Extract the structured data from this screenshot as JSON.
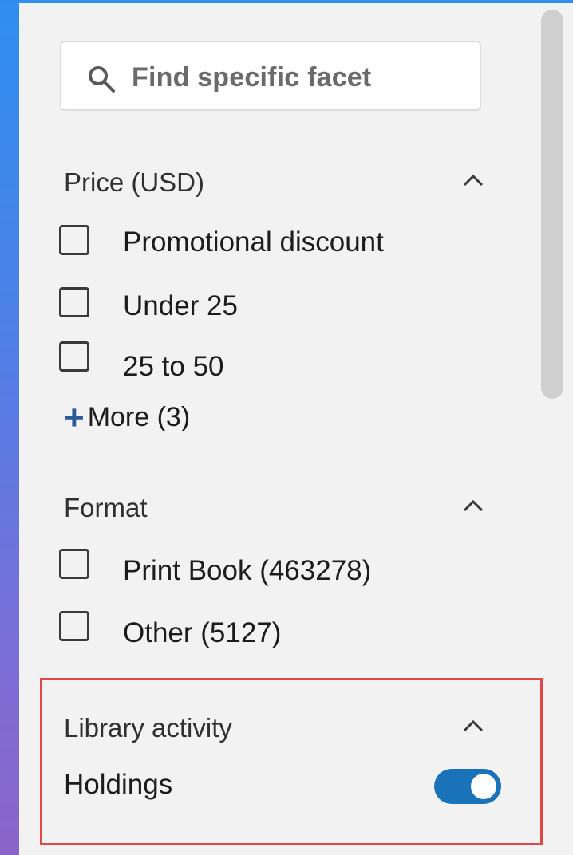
{
  "search": {
    "placeholder": "Find specific facet"
  },
  "sections": [
    {
      "title": "Price (USD)",
      "options": [
        {
          "label": "Promotional discount",
          "checked": false
        },
        {
          "label": "Under 25",
          "checked": false
        },
        {
          "label": "25 to 50",
          "checked": false
        }
      ],
      "more_label": "More (3)"
    },
    {
      "title": "Format",
      "options": [
        {
          "label": "Print Book (463278)",
          "checked": false
        },
        {
          "label": "Other (5127)",
          "checked": false
        }
      ]
    },
    {
      "title": "Library activity",
      "toggle": {
        "label": "Holdings",
        "on": true
      }
    }
  ],
  "icons": {
    "search": "search-icon",
    "collapse": "chevron-up-icon",
    "more": "plus-icon"
  },
  "colors": {
    "accent": "#1a73b8",
    "highlight_border": "#e04848",
    "more_plus": "#2c5a9c"
  }
}
